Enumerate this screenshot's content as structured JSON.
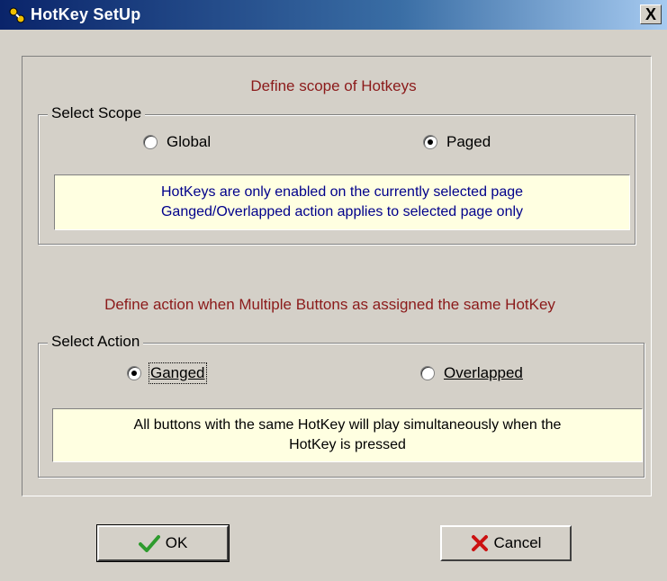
{
  "window": {
    "title": "HotKey SetUp",
    "close_label": "X"
  },
  "scope": {
    "heading": "Define scope of Hotkeys",
    "legend": "Select Scope",
    "options": [
      {
        "label": "Global",
        "selected": false
      },
      {
        "label": "Paged",
        "selected": true
      }
    ],
    "info_line1": "HotKeys are only enabled on the currently selected page",
    "info_line2": "Ganged/Overlapped action applies to selected page only"
  },
  "action": {
    "heading": "Define action when Multiple Buttons as assigned the same HotKey",
    "legend": "Select Action",
    "options": [
      {
        "label": "Ganged",
        "selected": true
      },
      {
        "label": "Overlapped",
        "selected": false
      }
    ],
    "info_line1": "All buttons with the same HotKey will play simultaneously when the",
    "info_line2": "HotKey is pressed"
  },
  "buttons": {
    "ok_label": "OK",
    "ok_icon": "checkmark-icon",
    "cancel_label": "Cancel",
    "cancel_icon": "x-mark-icon"
  },
  "colors": {
    "title_gradient_start": "#0a246a",
    "heading_red": "#8b1a1a",
    "info_background": "#ffffe1",
    "info_text_blue": "#00008b",
    "ok_green": "#2e9b2e",
    "cancel_red": "#cc1111"
  }
}
